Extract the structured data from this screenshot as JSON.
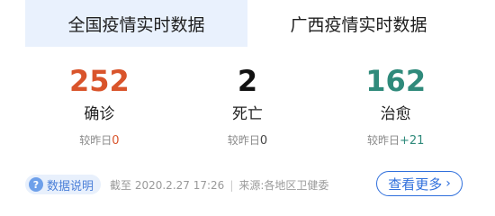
{
  "tabs": [
    {
      "label": "全国疫情实时数据",
      "active": false
    },
    {
      "label": "广西疫情实时数据",
      "active": true
    }
  ],
  "stats": [
    {
      "value": "252",
      "label": "确诊",
      "compare_prefix": "较昨日",
      "compare_value": "0",
      "color": "#d9542b",
      "delta_color": "#d9542b"
    },
    {
      "value": "2",
      "label": "死亡",
      "compare_prefix": "较昨日",
      "compare_value": "0",
      "color": "#111111",
      "delta_color": "#444444"
    },
    {
      "value": "162",
      "label": "治愈",
      "compare_prefix": "较昨日",
      "compare_value": "+21",
      "color": "#2f8a7b",
      "delta_color": "#2f8a7b"
    }
  ],
  "footer": {
    "info_label": "数据说明",
    "info_icon": "?",
    "deadline": "截至 2020.2.27 17:26",
    "separator": "|",
    "source": "来源:各地区卫健委",
    "more_label": "查看更多"
  },
  "colors": {
    "accent": "#2f6fdc",
    "tab_inactive_bg": "#e9f1fd"
  }
}
